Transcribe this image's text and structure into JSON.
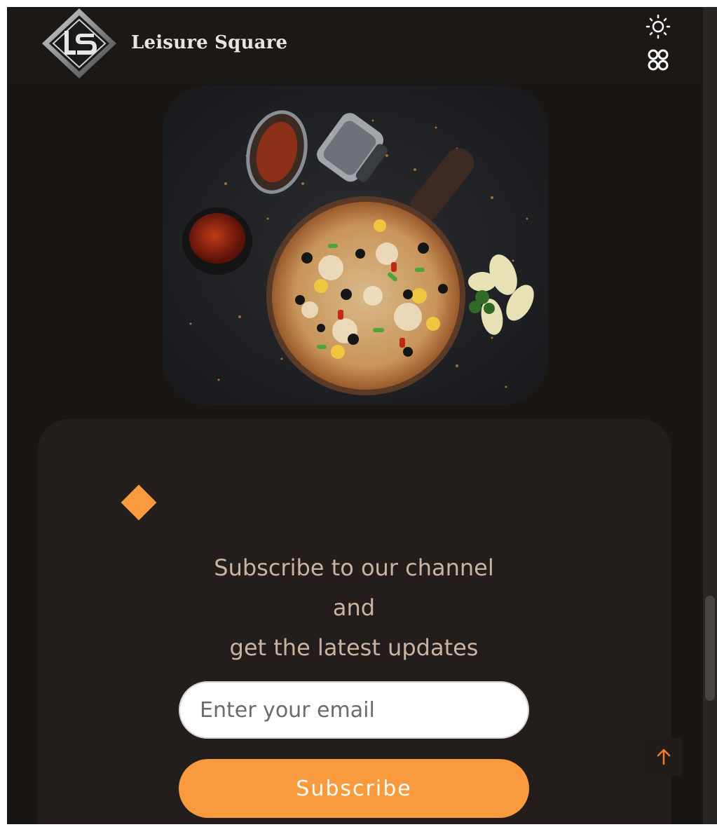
{
  "header": {
    "brand": "Leisure Square",
    "logo_letters": "LS",
    "icons": {
      "theme": "sun-icon",
      "menu": "apps-grid-icon"
    }
  },
  "hero": {
    "alt": "Pizza with chili flakes, sauce and seasoning on dark background"
  },
  "newsletter": {
    "line1": "Subscribe to our channel",
    "line2": "and",
    "line3": "get the latest updates",
    "email_placeholder": "Enter your email",
    "email_value": "",
    "button_label": "Subscribe"
  },
  "back_to_top": {
    "icon": "arrow-up-icon"
  },
  "colors": {
    "background": "#1a1614",
    "card": "#231e1c",
    "accent": "#f89a3d",
    "headline": "#c9b4a3"
  }
}
